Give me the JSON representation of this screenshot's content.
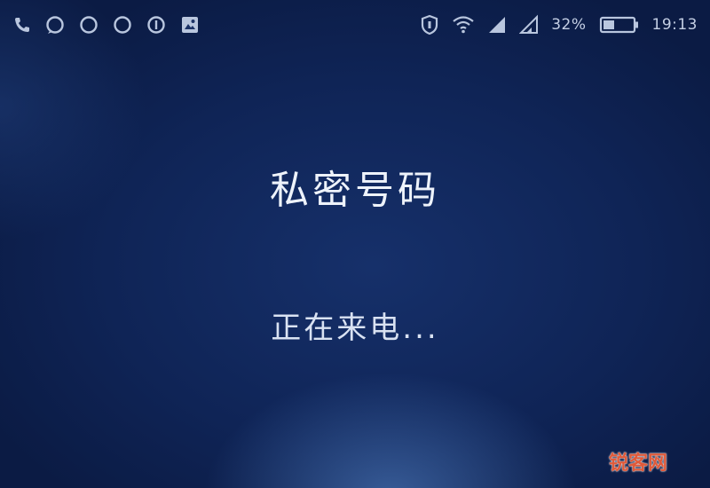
{
  "status_bar": {
    "left_icons": [
      "phone-icon",
      "chat-bubble-icon",
      "chat-bubble-icon",
      "chat-bubble-icon",
      "info-icon",
      "gallery-icon"
    ],
    "right_icons": [
      "shield-icon",
      "wifi-icon",
      "signal-icon",
      "signal-icon",
      "battery-icon"
    ],
    "battery_percent": "32%",
    "time": "19:13"
  },
  "call": {
    "caller_name": "私密号码",
    "status_text": "正在来电..."
  },
  "watermark": "锐客网"
}
